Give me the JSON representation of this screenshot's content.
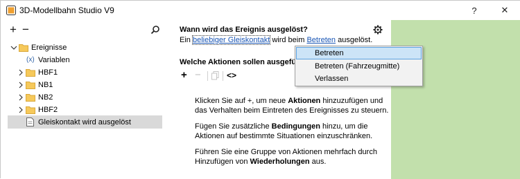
{
  "window": {
    "title": "3D-Modellbahn Studio V9",
    "help_glyph": "?",
    "close_glyph": "✕"
  },
  "left": {
    "add_glyph": "+",
    "remove_glyph": "−",
    "tree": [
      {
        "label": "Ereignisse",
        "icon": "folder-icon",
        "expanded": true
      },
      {
        "label": "Variablen",
        "icon": "variable-icon",
        "prefix": "(x)"
      },
      {
        "label": "HBF1",
        "icon": "folder-icon"
      },
      {
        "label": "NB1",
        "icon": "folder-icon"
      },
      {
        "label": "NB2",
        "icon": "folder-icon"
      },
      {
        "label": "HBF2",
        "icon": "folder-icon"
      },
      {
        "label": "Gleiskontakt wird ausgelöst",
        "icon": "document-icon",
        "selected": true
      }
    ]
  },
  "right": {
    "trigger_title": "Wann wird das Ereignis ausgelöst?",
    "sentence": {
      "pre": "Ein ",
      "link1": "beliebiger Gleiskontakt",
      "mid": " wird beim ",
      "link2": "Betreten",
      "post": " ausgelöst."
    },
    "actions_title": "Welche Aktionen sollen ausgeführt",
    "action_tools": {
      "add": "+",
      "remove": "−",
      "wrap": "<>"
    },
    "help": {
      "p1_pre": "Klicken Sie auf +, um neue ",
      "p1_bold": "Aktionen",
      "p1_post": " hinzuzufügen und das Verhalten beim Eintreten des Ereignisses zu steuern.",
      "p2_pre": "Fügen Sie zusätzliche ",
      "p2_bold": "Bedingungen",
      "p2_post": " hinzu, um die Aktionen auf bestimmte Situationen einzuschränken.",
      "p3_pre": "Führen Sie eine Gruppe von Aktionen mehrfach durch Hinzufügen von ",
      "p3_bold": "Wiederholungen",
      "p3_post": " aus."
    }
  },
  "dropdown": {
    "options": [
      "Betreten",
      "Betreten (Fahrzeugmitte)",
      "Verlassen"
    ],
    "highlighted": "Betreten"
  },
  "colors": {
    "green_panel": "#c2e0ac",
    "link": "#1a56b5",
    "highlight": "#cce4f7",
    "folder": "#f6c95b"
  }
}
